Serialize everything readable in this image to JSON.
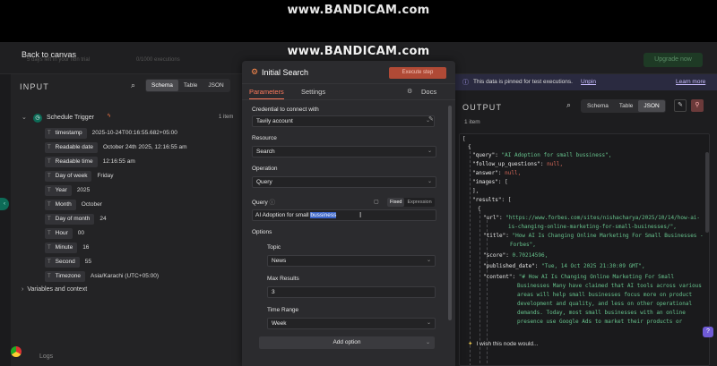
{
  "watermark": {
    "top": "www.BANDICAM.com",
    "mid": "www.BANDICAM.com"
  },
  "topbar": {
    "back": "Back to canvas",
    "trial_text": "5 days left in your n8n trial",
    "exec_text": "0/1000 executions",
    "upgrade": "Upgrade now"
  },
  "input": {
    "title": "INPUT",
    "view_tabs": [
      "Schema",
      "Table",
      "JSON"
    ],
    "active_tab": "Schema",
    "trigger": {
      "name": "Schedule Trigger",
      "count": "1 item"
    },
    "fields": [
      {
        "key": "timestamp",
        "value": "2025-10-24T00:16:55.682+05:00"
      },
      {
        "key": "Readable date",
        "value": "October 24th 2025, 12:16:55 am"
      },
      {
        "key": "Readable time",
        "value": "12:16:55 am"
      },
      {
        "key": "Day of week",
        "value": "Friday"
      },
      {
        "key": "Year",
        "value": "2025"
      },
      {
        "key": "Month",
        "value": "October"
      },
      {
        "key": "Day of month",
        "value": "24"
      },
      {
        "key": "Hour",
        "value": "00"
      },
      {
        "key": "Minute",
        "value": "16"
      },
      {
        "key": "Second",
        "value": "55"
      },
      {
        "key": "Timezone",
        "value": "Asia/Karachi (UTC+05:00)"
      }
    ],
    "vars": "Variables and context",
    "logs": "Logs"
  },
  "node": {
    "title": "Initial Search",
    "execute": "Execute step",
    "tab_parameters": "Parameters",
    "tab_settings": "Settings",
    "docs": "Docs",
    "credential_label": "Credential to connect with",
    "credential_value": "Tavily account",
    "resource_label": "Resource",
    "resource_value": "Search",
    "operation_label": "Operation",
    "operation_value": "Query",
    "query_label": "Query",
    "query_fixed": "Fixed",
    "query_expression": "Expression",
    "query_text_before": "AI Adoption for small ",
    "query_text_selected": "bussiness",
    "options_label": "Options",
    "topic_label": "Topic",
    "topic_value": "News",
    "max_results_label": "Max Results",
    "max_results_value": "3",
    "time_range_label": "Time Range",
    "time_range_value": "Week",
    "add_option": "Add option"
  },
  "output": {
    "pinned_text": "This data is pinned for test executions.",
    "unpin": "Unpin",
    "learn_more": "Learn more",
    "title": "OUTPUT",
    "view_tabs": [
      "Schema",
      "Table",
      "JSON"
    ],
    "active_tab": "JSON",
    "items": "1 item",
    "json": {
      "query": "\"AI Adoption for small bussiness\",",
      "follow_up": "null,",
      "answer": "null,",
      "images": "[",
      "url": "\"https://www.forbes.com/sites/nishacharya/2025/10/14/how-ai-",
      "url2": "is-changing-online-marketing-for-small-businesses/\",",
      "title1": "\"How AI Is Changing Online Marketing For Small Businesses -",
      "title2": "Forbes\",",
      "score": "0.70214596,",
      "published_date": "\"Tue, 14 Oct 2025 21:30:09 GMT\",",
      "content1": "\"# How AI Is Changing Online Marketing For Small",
      "content2": "Businesses Many have claimed that AI tools across various",
      "content3": "areas will help small businesses focus more on product",
      "content4": "development and quality, and less on other operational",
      "content5": "demands. Today, most small businesses with an online",
      "content6": "presence use Google Ads to market their products or"
    },
    "feedback": "I wish this node would..."
  }
}
